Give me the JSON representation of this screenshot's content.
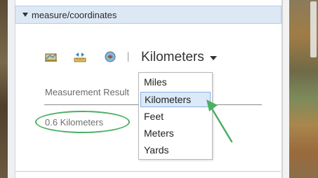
{
  "panel": {
    "title": "measure/coordinates"
  },
  "toolbar": {
    "tools": [
      {
        "name": "area",
        "icon": "area-tool-icon"
      },
      {
        "name": "distance",
        "icon": "distance-tool-icon"
      },
      {
        "name": "location",
        "icon": "location-tool-icon"
      }
    ],
    "unit_selected": "Kilometers"
  },
  "dropdown": {
    "options": [
      "Miles",
      "Kilometers",
      "Feet",
      "Meters",
      "Yards"
    ],
    "selected_index": 1
  },
  "result": {
    "label": "Measurement Result",
    "value": "0.6 Kilometers"
  },
  "colors": {
    "header_bg": "#dde8f5",
    "highlight_bg": "#dbe9f9",
    "annotation_green": "#4caf64"
  }
}
